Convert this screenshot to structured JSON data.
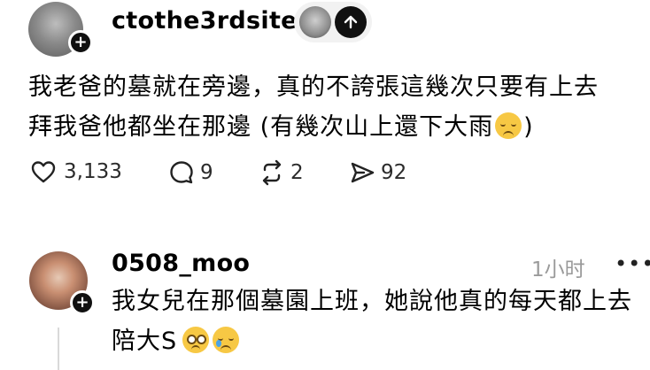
{
  "post": {
    "username": "ctothe3rdsite",
    "text_line1": "我老爸的墓就在旁邊，真的不誇張這幾次只要有上去",
    "text_line2": "拜我爸他都坐在那邊 (有幾次山上還下大雨",
    "text_line2_end": ")",
    "emoji": "pensive-face",
    "actions": {
      "likes": "3,133",
      "replies": "9",
      "reposts": "2",
      "shares": "92"
    }
  },
  "reply": {
    "username": "0508_moo",
    "timestamp": "1小时",
    "more_label": "•••",
    "text_line1": "我女兒在那個墓園上班，她說他真的每天都上去",
    "text_line2": "陪大S",
    "emojis": [
      "pleading-face",
      "crying-face"
    ]
  },
  "icons": {
    "like": "heart-icon",
    "reply": "comment-bubble-icon",
    "repost": "repost-arrows-icon",
    "share": "send-icon",
    "follow": "plus-icon",
    "scroll_up": "arrow-up-icon"
  }
}
